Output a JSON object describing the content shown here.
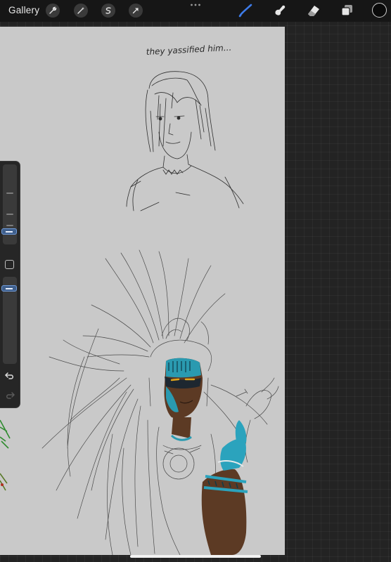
{
  "topbar": {
    "gallery_label": "Gallery",
    "left_tools": [
      {
        "name": "actions",
        "icon": "wrench-icon"
      },
      {
        "name": "adjustments",
        "icon": "magic-wand-icon"
      },
      {
        "name": "selection",
        "icon": "selection-s-icon"
      },
      {
        "name": "transform",
        "icon": "arrow-cursor-icon"
      }
    ],
    "more_icon": "ellipsis-icon",
    "right_tools": [
      {
        "name": "brush",
        "icon": "brush-icon",
        "active": true
      },
      {
        "name": "smudge",
        "icon": "smudge-icon",
        "active": false
      },
      {
        "name": "eraser",
        "icon": "eraser-icon",
        "active": false
      },
      {
        "name": "layers",
        "icon": "layers-icon",
        "active": false
      }
    ],
    "current_color": "#0a0a0a",
    "active_tool_color": "#3d7be8"
  },
  "sidebar": {
    "brush_size_icon": "slider-handle",
    "opacity_icon": "slider-handle",
    "modify_icon": "square-modify-icon",
    "undo_icon": "undo-arrow-icon",
    "redo_icon": "redo-arrow-icon"
  },
  "canvas": {
    "handwritten_note": "they yassified him...",
    "background_color": "#c9c9c9"
  }
}
